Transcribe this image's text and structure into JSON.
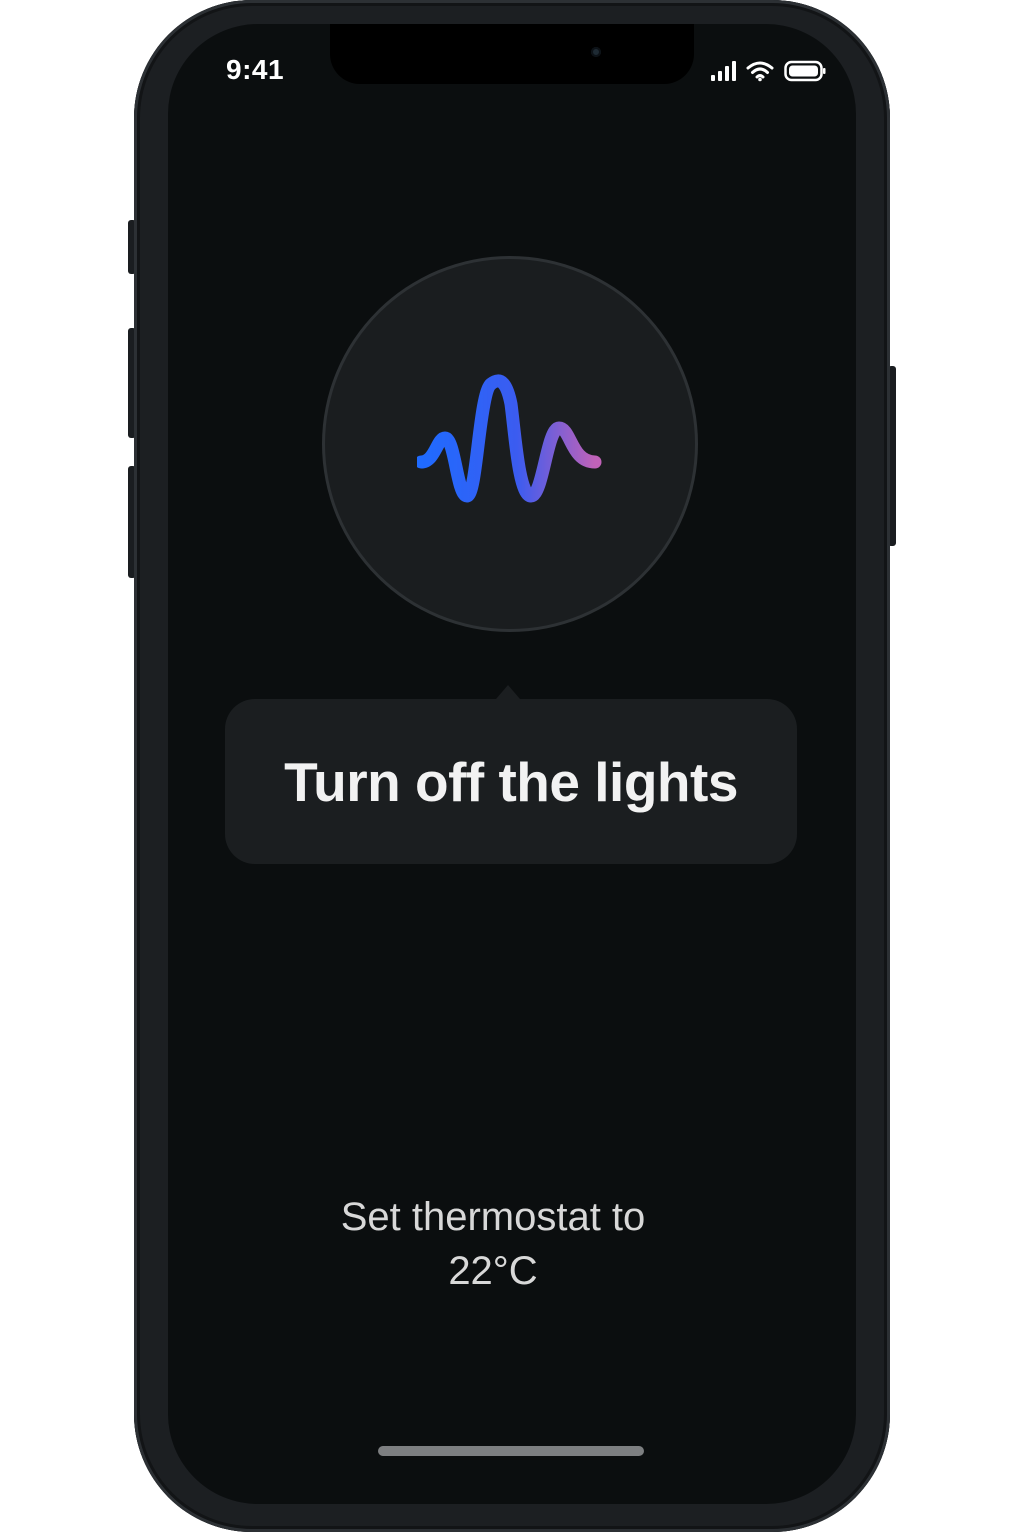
{
  "status_bar": {
    "time": "9:41",
    "icons": [
      "cellular-signal-icon",
      "wifi-icon",
      "battery-icon"
    ]
  },
  "assistant": {
    "icon": "voice-waveform-icon",
    "gradient_start": "#1f6bff",
    "gradient_end": "#c062b8"
  },
  "transcript": {
    "text": "Turn off the lights"
  },
  "suggestion": {
    "line1": "Set thermostat to",
    "line2": "22°C"
  },
  "colors": {
    "screen_background": "#0b0e0f",
    "bubble_background": "#1b1e20",
    "text_primary": "#f2f2f2",
    "text_secondary": "#d8d8d8"
  }
}
